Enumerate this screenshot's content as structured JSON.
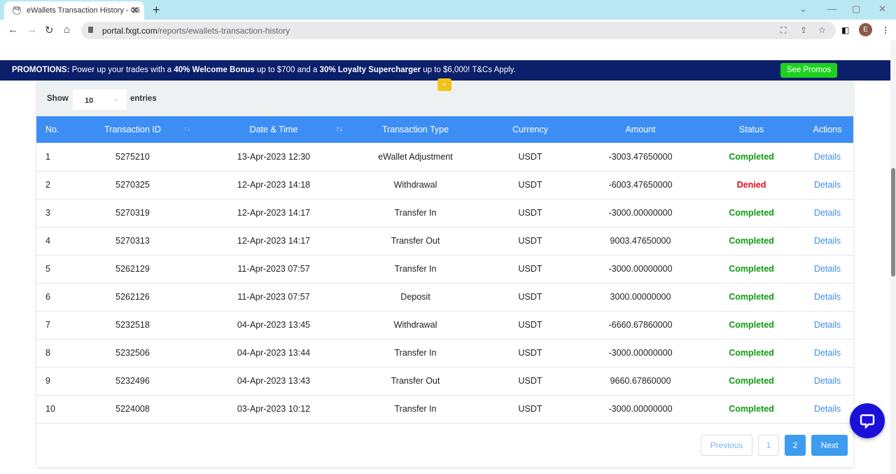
{
  "browser": {
    "tab_title": "eWallets Transaction History - Cli",
    "url_host": "portal.fxgt.com",
    "url_path": "/reports/ewallets-transaction-history",
    "avatar_letter": "E"
  },
  "promo": {
    "label": "PROMOTIONS:",
    "t1": " Power up your trades with a ",
    "b1": "40% Welcome Bonus",
    "t2": " up to $700 and a ",
    "b2": "30% Loyalty Supercharger",
    "t3": " up to $6,000! T&Cs Apply.",
    "button": "See Promos"
  },
  "toolbar": {
    "show": "Show",
    "entries_value": "10",
    "entries": "entries"
  },
  "table": {
    "headers": [
      "No.",
      "Transaction ID",
      "Date & Time",
      "Transaction Type",
      "Currency",
      "Amount",
      "Status",
      "Actions"
    ],
    "rows": [
      {
        "no": "1",
        "id": "5275210",
        "date": "13-Apr-2023 12:30",
        "type": "eWallet Adjustment",
        "cur": "USDT",
        "amount": "-3003.47650000",
        "status": "Completed",
        "action": "Details"
      },
      {
        "no": "2",
        "id": "5270325",
        "date": "12-Apr-2023 14:18",
        "type": "Withdrawal",
        "cur": "USDT",
        "amount": "-6003.47650000",
        "status": "Denied",
        "action": "Details"
      },
      {
        "no": "3",
        "id": "5270319",
        "date": "12-Apr-2023 14:17",
        "type": "Transfer In",
        "cur": "USDT",
        "amount": "-3000.00000000",
        "status": "Completed",
        "action": "Details"
      },
      {
        "no": "4",
        "id": "5270313",
        "date": "12-Apr-2023 14:17",
        "type": "Transfer Out",
        "cur": "USDT",
        "amount": "9003.47650000",
        "status": "Completed",
        "action": "Details"
      },
      {
        "no": "5",
        "id": "5262129",
        "date": "11-Apr-2023 07:57",
        "type": "Transfer In",
        "cur": "USDT",
        "amount": "-3000.00000000",
        "status": "Completed",
        "action": "Details"
      },
      {
        "no": "6",
        "id": "5262126",
        "date": "11-Apr-2023 07:57",
        "type": "Deposit",
        "cur": "USDT",
        "amount": "3000.00000000",
        "status": "Completed",
        "action": "Details"
      },
      {
        "no": "7",
        "id": "5232518",
        "date": "04-Apr-2023 13:45",
        "type": "Withdrawal",
        "cur": "USDT",
        "amount": "-6660.67860000",
        "status": "Completed",
        "action": "Details"
      },
      {
        "no": "8",
        "id": "5232506",
        "date": "04-Apr-2023 13:44",
        "type": "Transfer In",
        "cur": "USDT",
        "amount": "-3000.00000000",
        "status": "Completed",
        "action": "Details"
      },
      {
        "no": "9",
        "id": "5232496",
        "date": "04-Apr-2023 13:43",
        "type": "Transfer Out",
        "cur": "USDT",
        "amount": "9660.67860000",
        "status": "Completed",
        "action": "Details"
      },
      {
        "no": "10",
        "id": "5224008",
        "date": "03-Apr-2023 10:12",
        "type": "Transfer In",
        "cur": "USDT",
        "amount": "-3000.00000000",
        "status": "Completed",
        "action": "Details"
      }
    ]
  },
  "pagination": {
    "previous": "Previous",
    "pages": [
      "1",
      "2"
    ],
    "current": "2",
    "next": "Next"
  }
}
